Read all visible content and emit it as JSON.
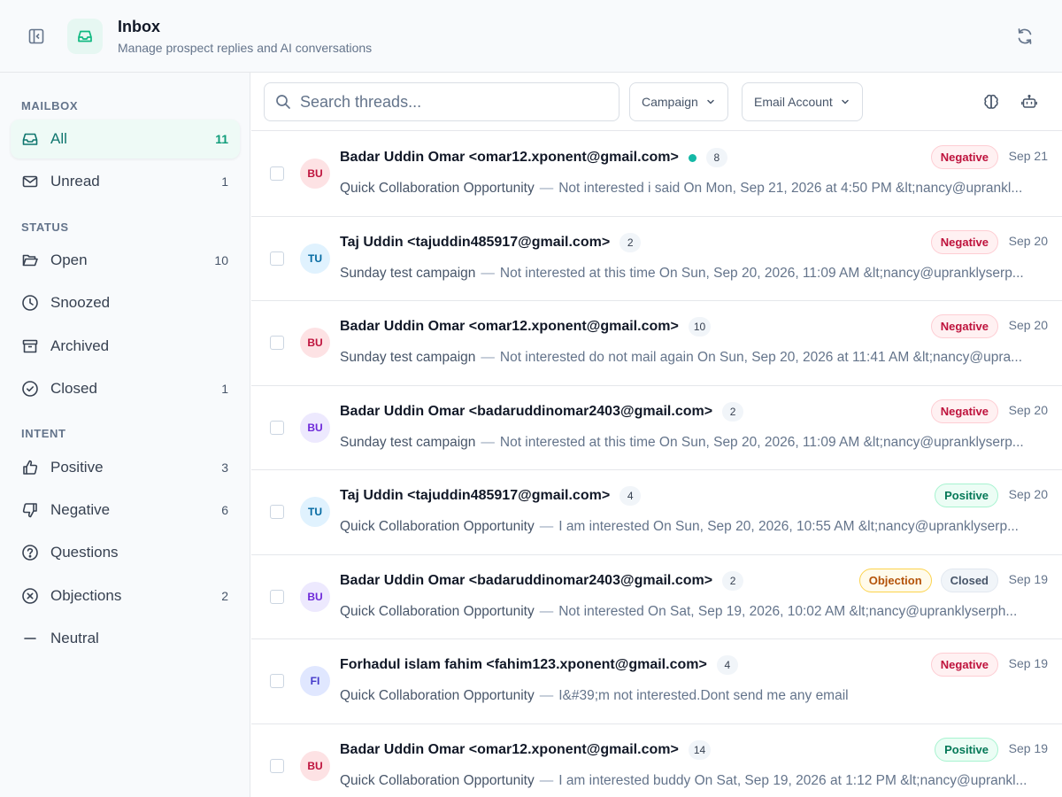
{
  "header": {
    "title": "Inbox",
    "subtitle": "Manage prospect replies and AI conversations",
    "collapse_icon": "sidebar-collapse-icon",
    "inbox_icon": "inbox-tray-icon",
    "refresh_icon": "refresh-icon"
  },
  "sidebar": {
    "mailbox_label": "MAILBOX",
    "status_label": "STATUS",
    "intent_label": "INTENT",
    "items": [
      {
        "label": "All",
        "count": "11",
        "icon": "inbox-icon"
      },
      {
        "label": "Unread",
        "count": "1",
        "icon": "envelope-icon"
      },
      {
        "label": "Open",
        "count": "10",
        "icon": "folder-open-icon"
      },
      {
        "label": "Snoozed",
        "count": "",
        "icon": "clock-icon"
      },
      {
        "label": "Archived",
        "count": "",
        "icon": "archive-icon"
      },
      {
        "label": "Closed",
        "count": "1",
        "icon": "check-circle-icon"
      },
      {
        "label": "Positive",
        "count": "3",
        "icon": "thumbs-up-icon"
      },
      {
        "label": "Negative",
        "count": "6",
        "icon": "thumbs-down-icon"
      },
      {
        "label": "Questions",
        "count": "",
        "icon": "question-circle-icon"
      },
      {
        "label": "Objections",
        "count": "2",
        "icon": "x-circle-icon"
      },
      {
        "label": "Neutral",
        "count": "",
        "icon": "minus-icon"
      }
    ]
  },
  "toolbar": {
    "search_placeholder": "Search threads...",
    "campaign_label": "Campaign",
    "email_account_label": "Email Account",
    "ai_icon": "brain-icon",
    "bot_icon": "robot-icon"
  },
  "colors": {
    "accent": "#10b981",
    "negative": "#be123c",
    "positive": "#047857",
    "objection": "#b45309"
  },
  "threads": [
    {
      "initials": "BU",
      "avatar_bg": "#fde2e4",
      "avatar_fg": "#be123c",
      "from": "Badar Uddin Omar <omar12.xponent@gmail.com>",
      "unread": true,
      "count": "8",
      "campaign": "Quick Collaboration Opportunity",
      "snippet": "Not interested i said On Mon, Sep 21, 2026 at 4:50 PM &lt;nancy@uprankl...",
      "tags": [
        {
          "text": "Negative",
          "kind": "negative"
        }
      ],
      "date": "Sep 21"
    },
    {
      "initials": "TU",
      "avatar_bg": "#e0f2fe",
      "avatar_fg": "#0369a1",
      "from": "Taj Uddin <tajuddin485917@gmail.com>",
      "unread": false,
      "count": "2",
      "campaign": "Sunday test campaign",
      "snippet": "Not interested at this time On Sun, Sep 20, 2026, 11:09 AM &lt;nancy@upranklyserp...",
      "tags": [
        {
          "text": "Negative",
          "kind": "negative"
        }
      ],
      "date": "Sep 20"
    },
    {
      "initials": "BU",
      "avatar_bg": "#fde2e4",
      "avatar_fg": "#be123c",
      "from": "Badar Uddin Omar <omar12.xponent@gmail.com>",
      "unread": false,
      "count": "10",
      "campaign": "Sunday test campaign",
      "snippet": "Not interested do not mail again On Sun, Sep 20, 2026 at 11:41 AM &lt;nancy@upra...",
      "tags": [
        {
          "text": "Negative",
          "kind": "negative"
        }
      ],
      "date": "Sep 20"
    },
    {
      "initials": "BU",
      "avatar_bg": "#ede9fe",
      "avatar_fg": "#6d28d9",
      "from": "Badar Uddin Omar <badaruddinomar2403@gmail.com>",
      "unread": false,
      "count": "2",
      "campaign": "Sunday test campaign",
      "snippet": "Not interested at this time On Sun, Sep 20, 2026, 11:09 AM &lt;nancy@upranklyserp...",
      "tags": [
        {
          "text": "Negative",
          "kind": "negative"
        }
      ],
      "date": "Sep 20"
    },
    {
      "initials": "TU",
      "avatar_bg": "#e0f2fe",
      "avatar_fg": "#0369a1",
      "from": "Taj Uddin <tajuddin485917@gmail.com>",
      "unread": false,
      "count": "4",
      "campaign": "Quick Collaboration Opportunity",
      "snippet": "I am interested On Sun, Sep 20, 2026, 10:55 AM &lt;nancy@upranklyserp...",
      "tags": [
        {
          "text": "Positive",
          "kind": "positive"
        }
      ],
      "date": "Sep 20"
    },
    {
      "initials": "BU",
      "avatar_bg": "#ede9fe",
      "avatar_fg": "#6d28d9",
      "from": "Badar Uddin Omar <badaruddinomar2403@gmail.com>",
      "unread": false,
      "count": "2",
      "campaign": "Quick Collaboration Opportunity",
      "snippet": "Not interested On Sat, Sep 19, 2026, 10:02 AM &lt;nancy@upranklyserph...",
      "tags": [
        {
          "text": "Objection",
          "kind": "objection"
        },
        {
          "text": "Closed",
          "kind": "closed"
        }
      ],
      "date": "Sep 19"
    },
    {
      "initials": "FI",
      "avatar_bg": "#e0e7ff",
      "avatar_fg": "#4338ca",
      "from": "Forhadul islam fahim <fahim123.xponent@gmail.com>",
      "unread": false,
      "count": "4",
      "campaign": "Quick Collaboration Opportunity",
      "snippet": "I&#39;m not interested.Dont send me any email",
      "tags": [
        {
          "text": "Negative",
          "kind": "negative"
        }
      ],
      "date": "Sep 19"
    },
    {
      "initials": "BU",
      "avatar_bg": "#fde2e4",
      "avatar_fg": "#be123c",
      "from": "Badar Uddin Omar <omar12.xponent@gmail.com>",
      "unread": false,
      "count": "14",
      "campaign": "Quick Collaboration Opportunity",
      "snippet": "I am interested buddy On Sat, Sep 19, 2026 at 1:12 PM &lt;nancy@uprankl...",
      "tags": [
        {
          "text": "Positive",
          "kind": "positive"
        }
      ],
      "date": "Sep 19"
    }
  ]
}
